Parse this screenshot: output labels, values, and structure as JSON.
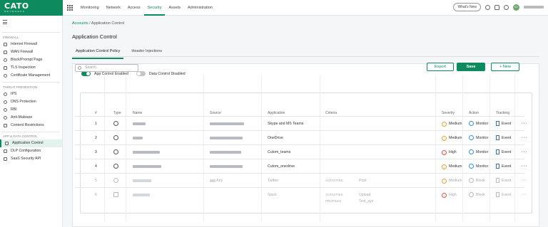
{
  "header": {
    "logo": "CATO",
    "logo_sub": "NETWORKS",
    "whats_new": "What's New",
    "avatar": "KV"
  },
  "nav": [
    "Monitoring",
    "Network",
    "Access",
    "Security",
    "Assets",
    "Administration"
  ],
  "sidebar": {
    "sections": [
      {
        "title": "FIREWALL",
        "items": [
          "Internet Firewall",
          "WAN Firewall",
          "Block/Prompt Page",
          "TLS Inspection",
          "Certificate Management"
        ]
      },
      {
        "title": "THREAT PREVENTION",
        "items": [
          "IPS",
          "DNS Protection",
          "RBI",
          "Anti-Malware",
          "Content Restrictions"
        ]
      },
      {
        "title": "APP & DATA CONTROL",
        "items": [
          "Application Control",
          "DLP Configuration",
          "SaaS Security API"
        ]
      }
    ]
  },
  "breadcrumb": {
    "parent": "Accounts",
    "sep": "/",
    "current": "Application Control"
  },
  "page_title": "Application Control",
  "tabs": [
    "Application Control Policy",
    "Header Injections"
  ],
  "toggles": {
    "app": "App Control Enabled",
    "data": "Data Control Disabled"
  },
  "search_placeholder": "Search",
  "buttons": {
    "export": "Export",
    "save": "Save",
    "new": "+ New"
  },
  "columns": [
    "#",
    "Type",
    "Name",
    "Source",
    "Application",
    "Criteria",
    "Severity",
    "Action",
    "Tracking"
  ],
  "rows": [
    {
      "n": "1",
      "app": "Skype and MS Teams",
      "crit_label": "",
      "crit_val": "",
      "crit2_label": "",
      "crit2_val": "",
      "sev": "Medium",
      "action": "Monitor",
      "track": "Event"
    },
    {
      "n": "2",
      "app": "OneDrive",
      "crit_label": "",
      "crit_val": "",
      "crit2_label": "",
      "crit2_val": "",
      "sev": "Medium",
      "action": "Monitor",
      "track": "Event"
    },
    {
      "n": "3",
      "app": "Cutom_teams",
      "crit_label": "",
      "crit_val": "",
      "crit2_label": "",
      "crit2_val": "",
      "sev": "High",
      "action": "Monitor",
      "track": "Event"
    },
    {
      "n": "4",
      "app": "Cutom_onedrive",
      "crit_label": "",
      "crit_val": "",
      "crit2_label": "",
      "crit2_val": "",
      "sev": "Medium",
      "action": "Monitor",
      "track": "Event"
    },
    {
      "n": "5",
      "app": "Twitter",
      "source": "Any",
      "crit_label": "ACTIVITIES",
      "crit_val": "Post",
      "crit2_label": "",
      "crit2_val": "",
      "sev": "Medium",
      "action": "Block",
      "track": "Event"
    },
    {
      "n": "6",
      "app": "Slack",
      "crit_label": "ACTIVITIES",
      "crit_val": "Upload",
      "crit2_label": "PROFILES",
      "crit2_val": "Test_xyz",
      "sev": "High",
      "action": "Block",
      "track": "Event"
    }
  ],
  "colors": {
    "accent": "#0e8a5f",
    "medium": "#e8a33c",
    "high": "#d9534f",
    "monitor": "#3a8fd9"
  }
}
